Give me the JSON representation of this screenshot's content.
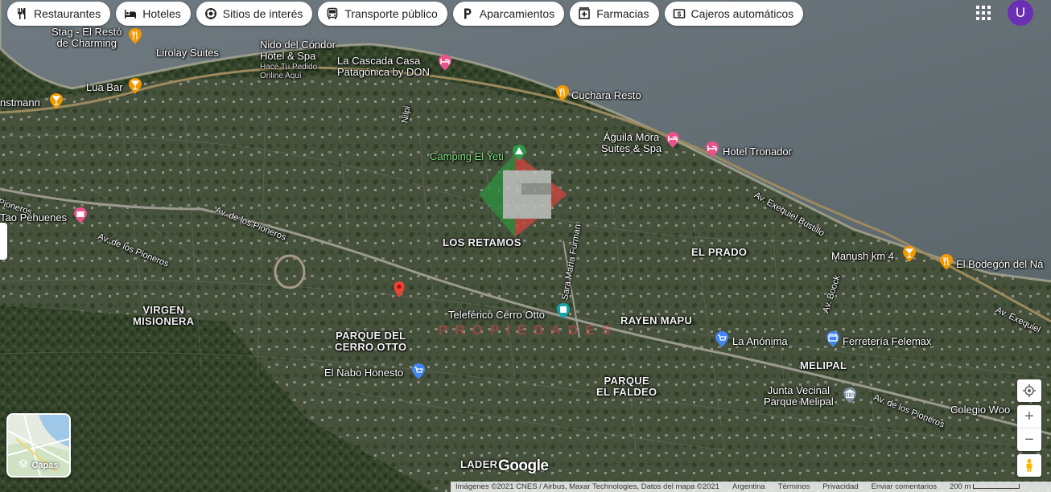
{
  "chips": [
    {
      "label": "Restaurantes",
      "icon": "fork-knife-icon"
    },
    {
      "label": "Hoteles",
      "icon": "bed-icon"
    },
    {
      "label": "Sitios de interés",
      "icon": "camera-icon"
    },
    {
      "label": "Transporte público",
      "icon": "bus-icon"
    },
    {
      "label": "Aparcamientos",
      "icon": "parking-icon"
    },
    {
      "label": "Farmacias",
      "icon": "pharmacy-icon"
    },
    {
      "label": "Cajeros automáticos",
      "icon": "atm-icon"
    }
  ],
  "account": {
    "initial": "U"
  },
  "places": {
    "stag": "Stag - El Restó\nde Charming",
    "lirolay": "Lirolay Suites",
    "nido": "Nido del Cóndor\nHotel & Spa",
    "nido_sub": "Hacé Tu Pedido\nOnline Aquí",
    "cascada": "La Cascada Casa\nPatagónica by DON",
    "luabar": "Lua Bar",
    "anstmann": "nstmann",
    "cuchara": "Cuchara Resto",
    "camping": "Camping El Yeti",
    "aguila": "Águila Mora\nSuites & Spa",
    "tronador": "Hotel Tronador",
    "pioneros_left": "Pioneros",
    "tao": "Tao Pehuenes",
    "teleferico": "Teleférico Cerro Otto",
    "anonima": "La Anónima",
    "ferreteria": "Ferretería Felemax",
    "manush": "Manush km 4",
    "bodegon": "El Bodegón del Ná",
    "nabo": "El Nabo Honesto",
    "junta": "Junta Vecinal\nParque Melipal",
    "colegio": "Colegio Woo"
  },
  "areas": {
    "los_retamos": "LOS RETAMOS",
    "el_prado": "EL PRADO",
    "virgen": "VIRGEN\nMISIONERA",
    "parque_otto": "PARQUE DEL\nCERRO OTTO",
    "rayen": "RAYEN MAPU",
    "melipal": "MELIPAL",
    "faldeo": "PARQUE\nEL FALDEO",
    "ladera": "LADER"
  },
  "roads": {
    "pioneros1": "Av. de los Pioneros",
    "pioneros2": "Av. de los Pioneros",
    "pioneros3": "Av. de los Pioneros",
    "bustillo": "Av. Exequiel Bustillo",
    "exequiel_right": "Av. Exequiel",
    "nilpi": "Nilpi",
    "furman": "Sara María Furman",
    "boock": "Av. Boock"
  },
  "watermark": "PROPIEDADES",
  "layers": {
    "label": "Capas"
  },
  "logo": "Google",
  "footer": {
    "imagery": "Imágenes ©2021 CNES / Airbus, Maxar Technologies, Datos del mapa ©2021",
    "country": "Argentina",
    "terms": "Términos",
    "privacy": "Privacidad",
    "feedback": "Enviar comentarios",
    "scale": "200 m"
  },
  "colors": {
    "accent": "#1a73e8",
    "avatar": "#6b2fb3",
    "restaurant_pin": "#f29900",
    "hotel_pin": "#e8548a",
    "shop_pin": "#4285f4",
    "red_marker": "#ea4335"
  }
}
